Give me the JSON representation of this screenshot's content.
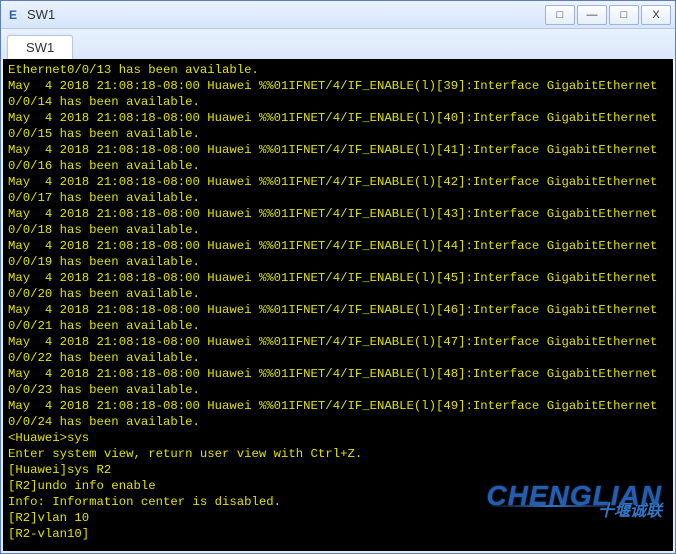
{
  "window": {
    "title": "SW1",
    "icon_glyph": "E",
    "buttons": {
      "option": "□",
      "minimize": "—",
      "maximize": "□",
      "close": "X"
    }
  },
  "tabs": {
    "active_label": "SW1"
  },
  "terminal": {
    "lines": [
      "Ethernet0/0/13 has been available.",
      "May  4 2018 21:08:18-08:00 Huawei %%01IFNET/4/IF_ENABLE(l)[39]:Interface GigabitEthernet0/0/14 has been available.",
      "May  4 2018 21:08:18-08:00 Huawei %%01IFNET/4/IF_ENABLE(l)[40]:Interface GigabitEthernet0/0/15 has been available.",
      "May  4 2018 21:08:18-08:00 Huawei %%01IFNET/4/IF_ENABLE(l)[41]:Interface GigabitEthernet0/0/16 has been available.",
      "May  4 2018 21:08:18-08:00 Huawei %%01IFNET/4/IF_ENABLE(l)[42]:Interface GigabitEthernet0/0/17 has been available.",
      "May  4 2018 21:08:18-08:00 Huawei %%01IFNET/4/IF_ENABLE(l)[43]:Interface GigabitEthernet0/0/18 has been available.",
      "May  4 2018 21:08:18-08:00 Huawei %%01IFNET/4/IF_ENABLE(l)[44]:Interface GigabitEthernet0/0/19 has been available.",
      "May  4 2018 21:08:18-08:00 Huawei %%01IFNET/4/IF_ENABLE(l)[45]:Interface GigabitEthernet0/0/20 has been available.",
      "May  4 2018 21:08:18-08:00 Huawei %%01IFNET/4/IF_ENABLE(l)[46]:Interface GigabitEthernet0/0/21 has been available.",
      "May  4 2018 21:08:18-08:00 Huawei %%01IFNET/4/IF_ENABLE(l)[47]:Interface GigabitEthernet0/0/22 has been available.",
      "May  4 2018 21:08:18-08:00 Huawei %%01IFNET/4/IF_ENABLE(l)[48]:Interface GigabitEthernet0/0/23 has been available.",
      "May  4 2018 21:08:18-08:00 Huawei %%01IFNET/4/IF_ENABLE(l)[49]:Interface GigabitEthernet0/0/24 has been available.",
      "<Huawei>sys",
      "Enter system view, return user view with Ctrl+Z.",
      "[Huawei]sys R2",
      "[R2]undo info enable",
      "Info: Information center is disabled.",
      "[R2]vlan 10",
      "[R2-vlan10]"
    ]
  },
  "watermark": {
    "latin": "CHENGLIAN",
    "cn": "十堰诚联"
  }
}
